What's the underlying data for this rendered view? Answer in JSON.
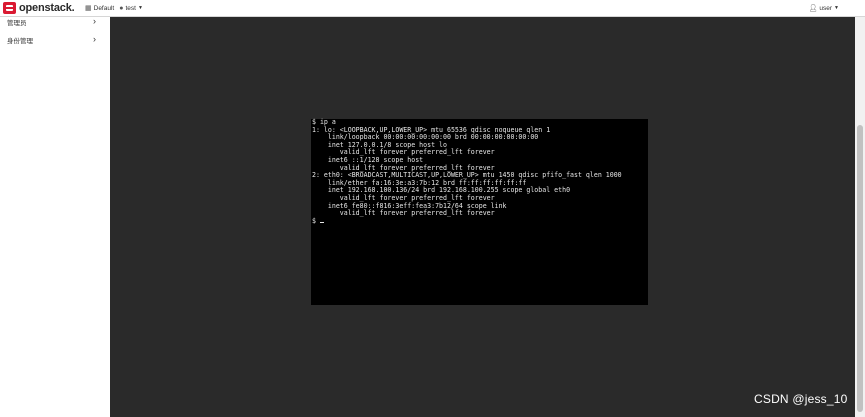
{
  "header": {
    "brand": "openstack.",
    "domain_label": "Default",
    "project_label": "test",
    "user_label": "user"
  },
  "icons": {
    "domain": "grid-icon",
    "project": "circle-icon",
    "user": "person-icon",
    "chevron": "chevron-right-icon",
    "caret": "caret-down-icon"
  },
  "sidebar": {
    "items": [
      {
        "label": "管理员"
      },
      {
        "label": "身份管理"
      }
    ]
  },
  "console": {
    "lines": [
      "$ ip a",
      "1: lo: <LOOPBACK,UP,LOWER_UP> mtu 65536 qdisc noqueue qlen 1",
      "    link/loopback 00:00:00:00:00:00 brd 00:00:00:00:00:00",
      "    inet 127.0.0.1/8 scope host lo",
      "       valid_lft forever preferred_lft forever",
      "    inet6 ::1/128 scope host",
      "       valid_lft forever preferred_lft forever",
      "2: eth0: <BROADCAST,MULTICAST,UP,LOWER_UP> mtu 1450 qdisc pfifo_fast qlen 1000",
      "    link/ether fa:16:3e:a3:7b:12 brd ff:ff:ff:ff:ff:ff",
      "    inet 192.168.100.136/24 brd 192.168.100.255 scope global eth0",
      "       valid_lft forever preferred_lft forever",
      "    inet6 fe80::f816:3eff:fea3:7b12/64 scope link",
      "       valid_lft forever preferred_lft forever",
      "$ "
    ]
  },
  "watermark": "CSDN @jess_10",
  "colors": {
    "brand_red": "#da1a32",
    "page_background": "#2a2a2a",
    "console_background": "#000000",
    "console_text": "#e6e6e6"
  }
}
